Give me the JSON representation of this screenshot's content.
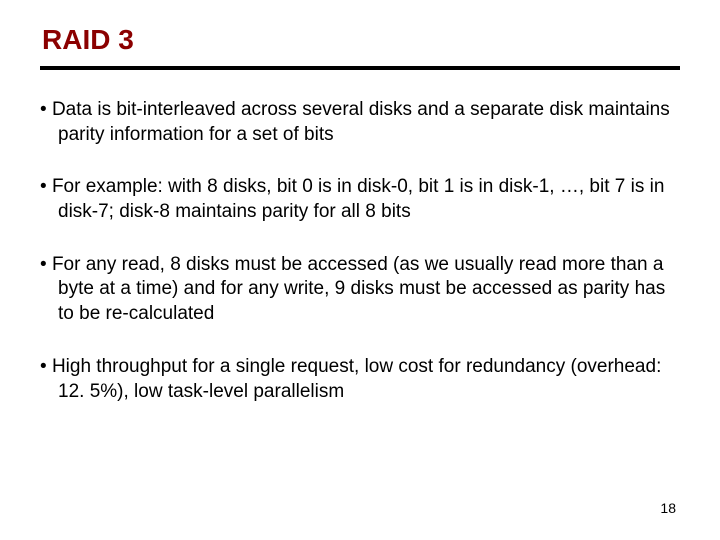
{
  "title": "RAID 3",
  "bullets": [
    "Data is bit-interleaved across several disks and a separate disk maintains parity information for a set of bits",
    "For example: with 8 disks, bit 0 is in disk-0, bit 1 is in disk-1, …, bit 7 is in disk-7; disk-8 maintains parity for all 8 bits",
    "For any read, 8 disks must be accessed (as we usually read more than a byte at a time) and for any write, 9 disks must be accessed as parity has to be re-calculated",
    "High throughput for a single request, low cost for redundancy (overhead: 12. 5%), low task-level parallelism"
  ],
  "page_number": "18"
}
